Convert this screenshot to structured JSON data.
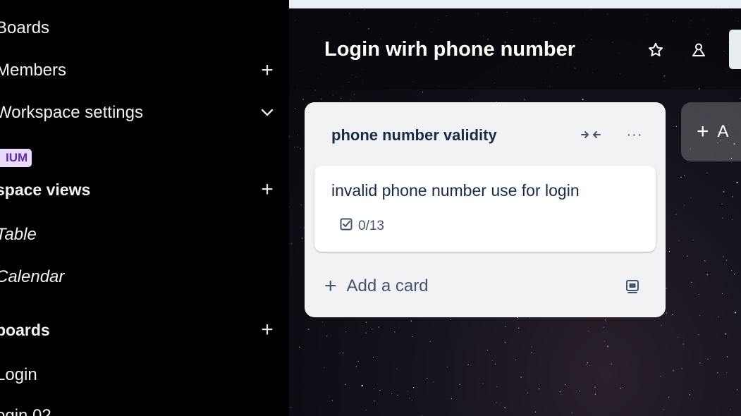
{
  "sidebar": {
    "boards_label": "Boards",
    "members_label": "Members",
    "workspace_settings_label": "Workspace settings",
    "premium_badge": "IUM",
    "workspace_views_label": "space views",
    "views": [
      "Table",
      "Calendar"
    ],
    "your_boards_label": "boards",
    "boards": [
      "Login",
      "ogin 02"
    ],
    "add_glyph": "+",
    "chevron_glyph": "⌄"
  },
  "board": {
    "title": "Login wirh phone number",
    "background_color": "#0b0b12"
  },
  "list": {
    "title": "phone number validity",
    "menu_glyph": "···",
    "cards": [
      {
        "title": "invalid phone number use for login",
        "checklist": "0/13"
      }
    ],
    "add_card_label": "Add a card"
  },
  "add_list": {
    "plus": "+",
    "label": "A"
  },
  "colors": {
    "premium_bg": "#e9d9fb",
    "premium_fg": "#5b2fb0",
    "list_bg": "#f1f2f4",
    "text_dark": "#172b4d"
  },
  "icons": [
    "star-icon",
    "people-icon",
    "collapse-icon",
    "more-icon",
    "checklist-icon",
    "template-icon",
    "plus-icon",
    "chevron-down-icon"
  ]
}
